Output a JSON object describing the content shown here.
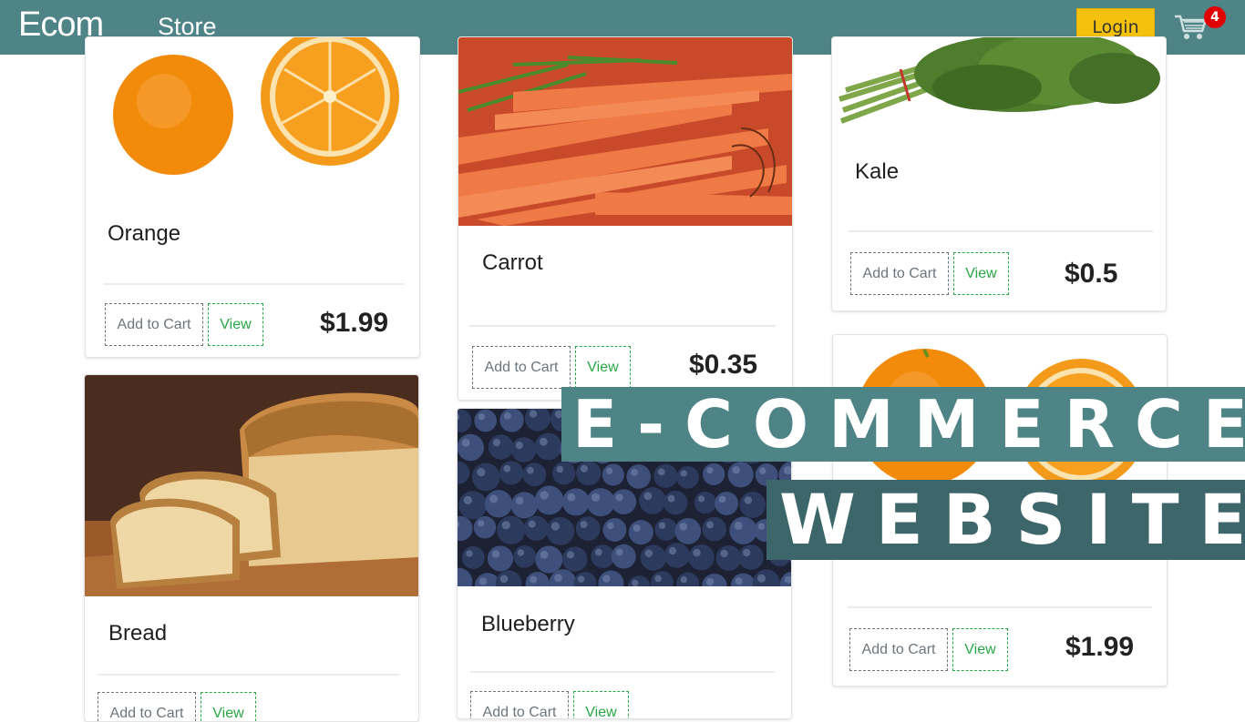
{
  "navbar": {
    "brand": "Ecom",
    "store_link": "Store",
    "login_label": "Login",
    "cart_count": "4"
  },
  "buttons": {
    "add_to_cart": "Add to Cart",
    "view": "View"
  },
  "products": [
    {
      "name": "Orange",
      "price": "$1.99"
    },
    {
      "name": "Carrot",
      "price": "$0.35"
    },
    {
      "name": "Kale",
      "price": "$0.5"
    },
    {
      "name": "Bread",
      "price": ""
    },
    {
      "name": "Blueberry",
      "price": ""
    },
    {
      "name": "",
      "price": "$1.99"
    }
  ],
  "banner": {
    "line1": "E-COMMERCE",
    "line2": "WEBSITE"
  },
  "colors": {
    "navbar": "#4f8487",
    "login_button": "#f4c20d",
    "cart_badge": "#e00000",
    "view_button": "#28a745",
    "add_button": "#6c757d",
    "banner_line1": "#4f8487",
    "banner_line2": "#3c6669"
  }
}
